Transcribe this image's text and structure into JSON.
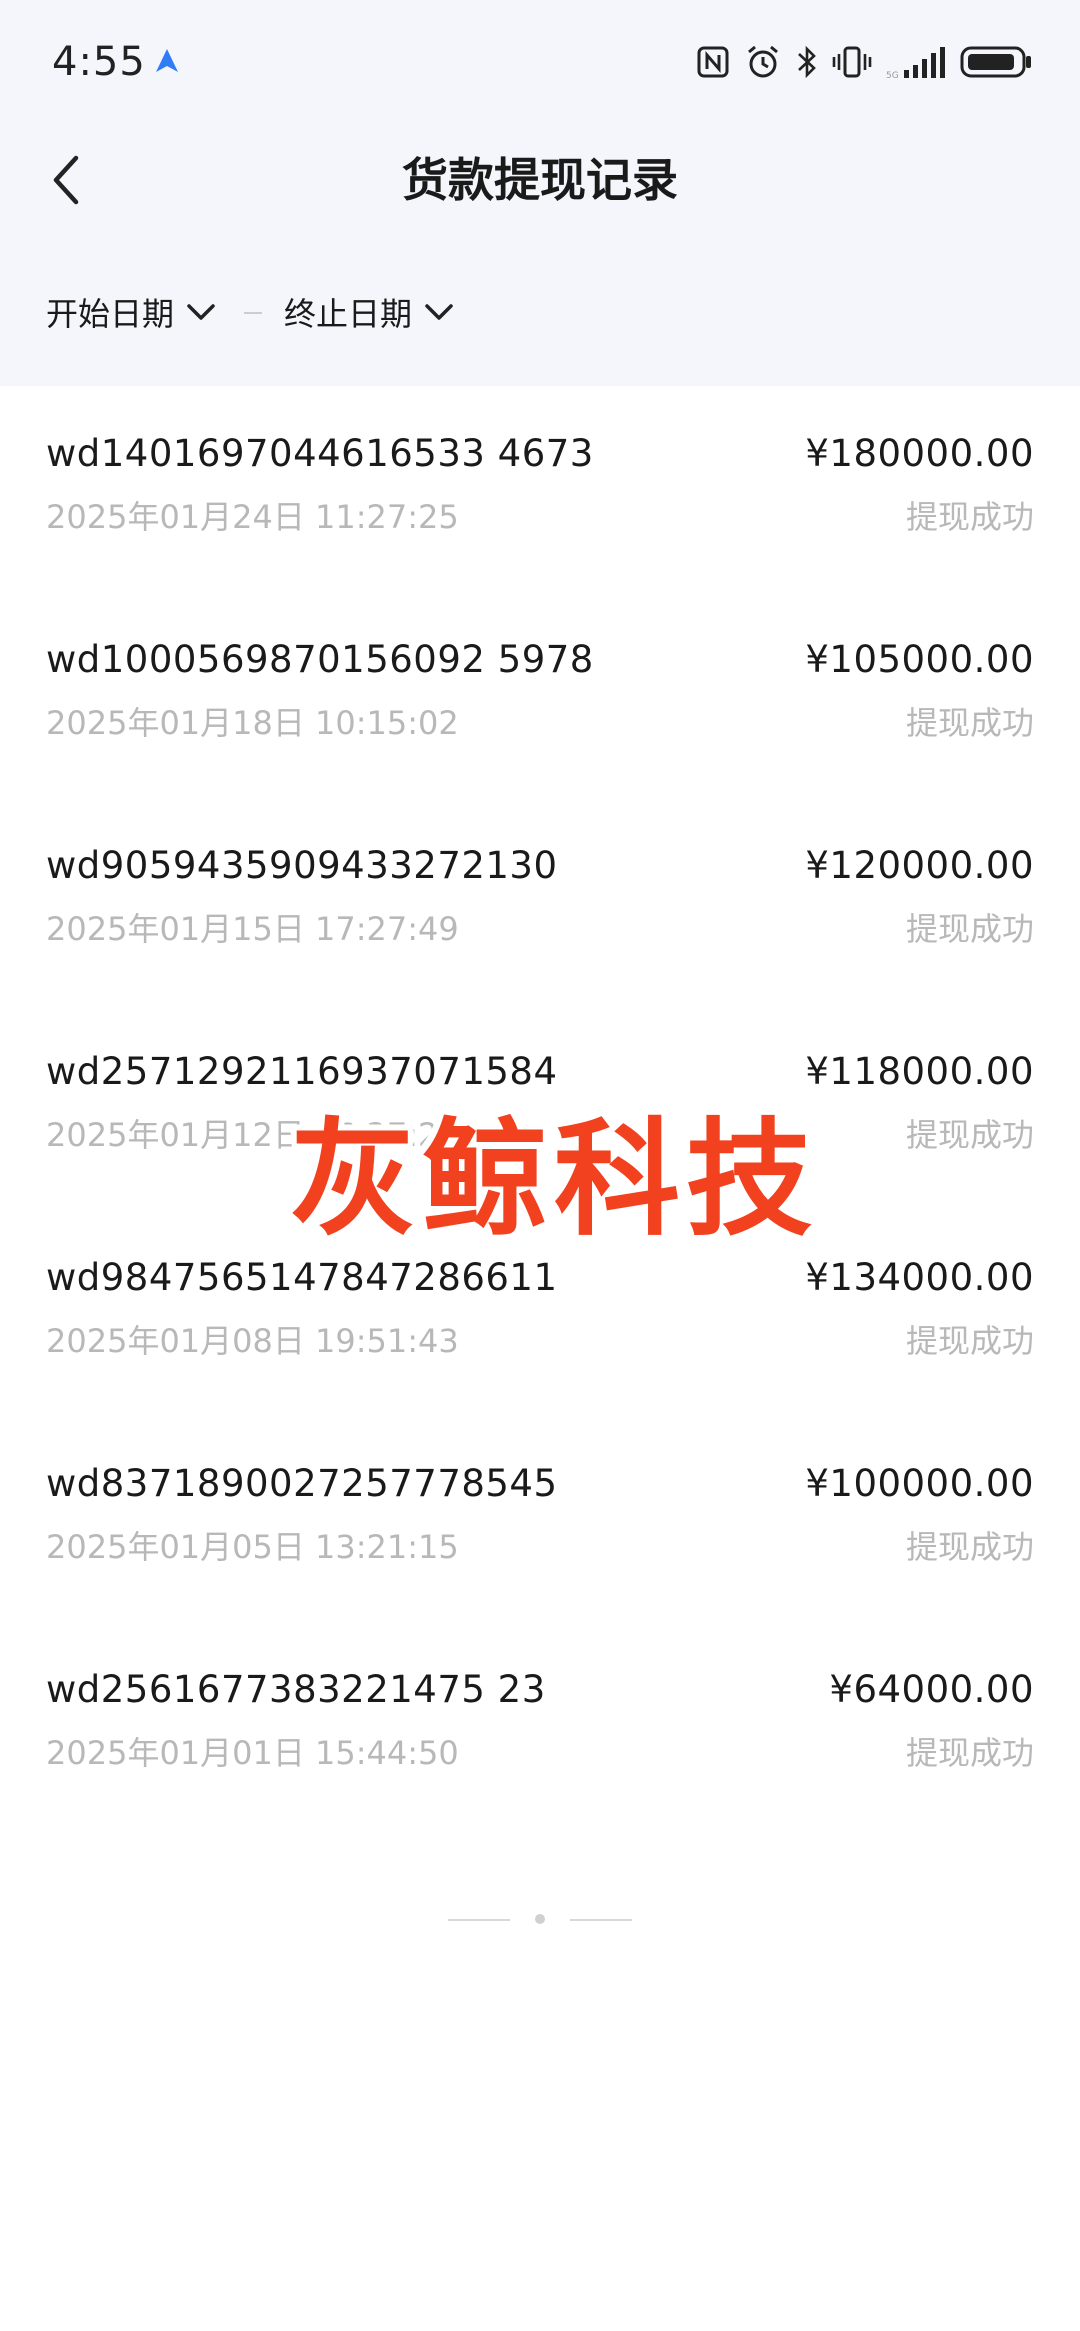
{
  "status_bar": {
    "time": "4:55",
    "icons": [
      "navigation-app-icon",
      "nfc-icon",
      "alarm-icon",
      "bluetooth-icon",
      "vibrate-icon",
      "signal-icon",
      "battery-icon"
    ]
  },
  "header": {
    "title": "货款提现记录",
    "back_icon": "chevron-left-icon"
  },
  "filters": {
    "start_date_label": "开始日期",
    "end_date_label": "终止日期",
    "dropdown_icon": "chevron-down-icon"
  },
  "records": [
    {
      "id": "wd1401697044616533 4673",
      "amount": "¥180000.00",
      "time": "2025年01月24日 11:27:25",
      "status": "提现成功"
    },
    {
      "id": "wd1000569870156092 5978",
      "amount": "¥105000.00",
      "time": "2025年01月18日 10:15:02",
      "status": "提现成功"
    },
    {
      "id": "wd9059435909433272130",
      "amount": "¥120000.00",
      "time": "2025年01月15日 17:27:49",
      "status": "提现成功"
    },
    {
      "id": "wd2571292116937071584",
      "amount": "¥118000.00",
      "time": "2025年01月12日 16:27:23",
      "status": "提现成功"
    },
    {
      "id": "wd9847565147847286611",
      "amount": "¥134000.00",
      "time": "2025年01月08日 19:51:43",
      "status": "提现成功"
    },
    {
      "id": "wd8371890027257778545",
      "amount": "¥100000.00",
      "time": "2025年01月05日 13:21:15",
      "status": "提现成功"
    },
    {
      "id": "wd2561677383221475 23",
      "amount": "¥64000.00",
      "time": "2025年01月01日 15:44:50",
      "status": "提现成功"
    }
  ],
  "watermark": "灰鲸科技",
  "colors": {
    "header_bg": "#f4f6fb",
    "secondary_text": "#b8b8b8",
    "watermark": "#f2411f"
  }
}
